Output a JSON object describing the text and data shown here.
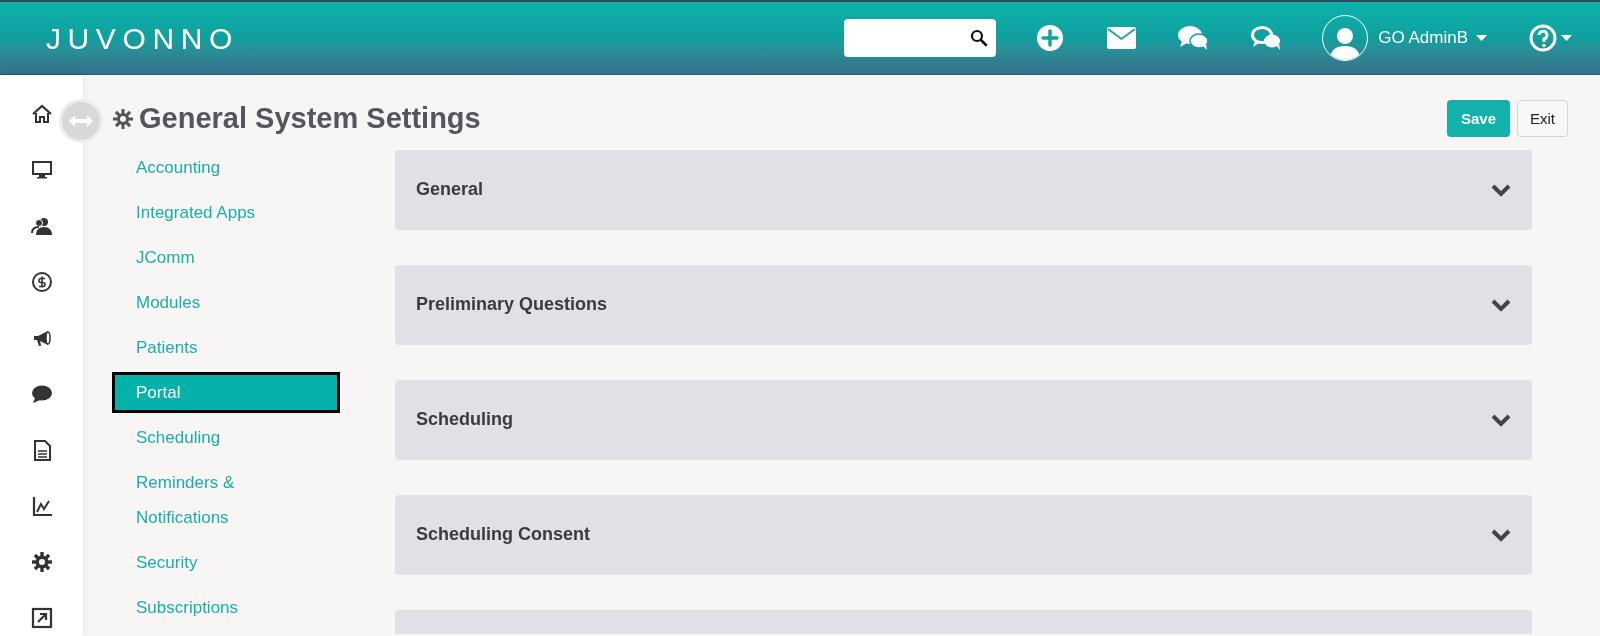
{
  "header": {
    "logo": "JUVONNO",
    "user": {
      "name": "GO AdminB"
    }
  },
  "rail": [
    {
      "kind": "home"
    },
    {
      "kind": "monitor"
    },
    {
      "kind": "users"
    },
    {
      "kind": "dollar"
    },
    {
      "kind": "megaphone"
    },
    {
      "kind": "chat"
    },
    {
      "kind": "document"
    },
    {
      "kind": "chart"
    },
    {
      "kind": "gear"
    },
    {
      "kind": "external"
    }
  ],
  "page": {
    "title": "General System Settings",
    "buttons": [
      {
        "label": "Save",
        "kind": "primary"
      },
      {
        "label": "Exit",
        "kind": "default"
      }
    ]
  },
  "nav": [
    {
      "label": "Accounting",
      "selected": false
    },
    {
      "label": "Integrated Apps",
      "selected": false
    },
    {
      "label": "JComm",
      "selected": false
    },
    {
      "label": "Modules",
      "selected": false
    },
    {
      "label": "Patients",
      "selected": false
    },
    {
      "label": "Portal",
      "selected": true
    },
    {
      "label": "Scheduling",
      "selected": false
    },
    {
      "label": "Reminders & Notifications",
      "selected": false
    },
    {
      "label": "Security",
      "selected": false
    },
    {
      "label": "Subscriptions",
      "selected": false
    }
  ],
  "sections": [
    {
      "title": "General",
      "expanded": false
    },
    {
      "title": "Preliminary Questions",
      "expanded": false
    },
    {
      "title": "Scheduling",
      "expanded": false
    },
    {
      "title": "Scheduling Consent",
      "expanded": false
    },
    {
      "kind": "partial"
    }
  ]
}
